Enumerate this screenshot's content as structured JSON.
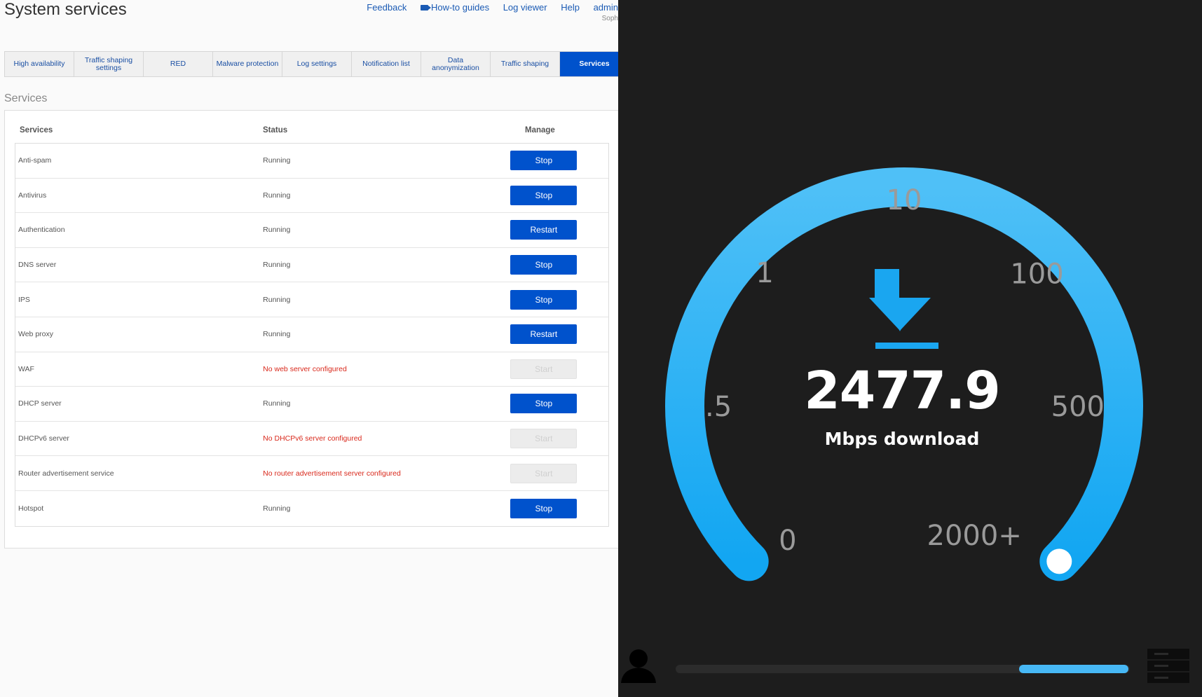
{
  "left": {
    "title": "System services",
    "top_links": {
      "feedback": "Feedback",
      "how_to": "How-to guides",
      "log_viewer": "Log viewer",
      "help": "Help",
      "admin": "admin"
    },
    "sub_note": "Soph",
    "tabs": [
      {
        "label": "High availability"
      },
      {
        "label": "Traffic shaping settings"
      },
      {
        "label": "RED"
      },
      {
        "label": "Malware protection"
      },
      {
        "label": "Log settings"
      },
      {
        "label": "Notification list"
      },
      {
        "label": "Data anonymization"
      },
      {
        "label": "Traffic shaping"
      },
      {
        "label": "Services",
        "active": true
      }
    ],
    "section_title": "Services",
    "table": {
      "headers": {
        "service": "Services",
        "status": "Status",
        "manage": "Manage"
      },
      "rows": [
        {
          "service": "Anti-spam",
          "status": "Running",
          "action": "Stop",
          "error": false,
          "enabled": true
        },
        {
          "service": "Antivirus",
          "status": "Running",
          "action": "Stop",
          "error": false,
          "enabled": true
        },
        {
          "service": "Authentication",
          "status": "Running",
          "action": "Restart",
          "error": false,
          "enabled": true
        },
        {
          "service": "DNS server",
          "status": "Running",
          "action": "Stop",
          "error": false,
          "enabled": true
        },
        {
          "service": "IPS",
          "status": "Running",
          "action": "Stop",
          "error": false,
          "enabled": true
        },
        {
          "service": "Web proxy",
          "status": "Running",
          "action": "Restart",
          "error": false,
          "enabled": true
        },
        {
          "service": "WAF",
          "status": "No web server configured",
          "action": "Start",
          "error": true,
          "enabled": false
        },
        {
          "service": "DHCP server",
          "status": "Running",
          "action": "Stop",
          "error": false,
          "enabled": true
        },
        {
          "service": "DHCPv6 server",
          "status": "No DHCPv6 server configured",
          "action": "Start",
          "error": true,
          "enabled": false
        },
        {
          "service": "Router advertisement service",
          "status": "No router advertisement server configured",
          "action": "Start",
          "error": true,
          "enabled": false
        },
        {
          "service": "Hotspot",
          "status": "Running",
          "action": "Stop",
          "error": false,
          "enabled": true
        }
      ]
    },
    "colors": {
      "primary": "#0052cc",
      "error": "#d9291c",
      "link": "#1a5ab4"
    }
  },
  "speedtest": {
    "value": "2477.9",
    "unit_label": "Mbps download",
    "scale_labels": [
      "0",
      ".5",
      "1",
      "10",
      "100",
      "500",
      "2000+"
    ],
    "progress": 0.24,
    "colors": {
      "arc": "#2aa8f2",
      "background": "#1d1d1d",
      "progress": "#47b8f5",
      "label": "#9a9a9a"
    },
    "icons": {
      "download": "download-arrow-icon",
      "user": "user-icon",
      "server": "server-icon"
    }
  }
}
